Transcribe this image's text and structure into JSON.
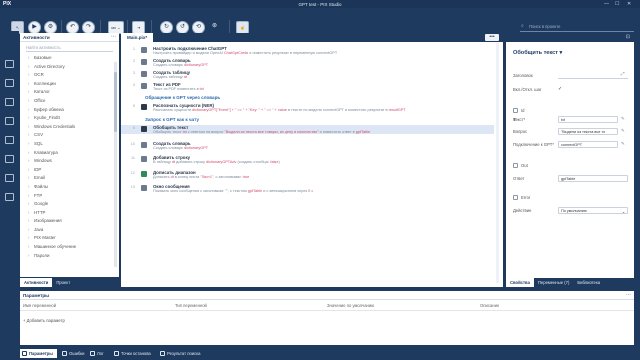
{
  "window": {
    "logo": "PIX",
    "title": "GPT test - PIX Studio"
  },
  "toolbar": {
    "speed_label": "мс ⌄",
    "search_placeholder": "Поиск в проекте"
  },
  "left_panel": {
    "title": "Активности",
    "filter_placeholder": "Найти активность",
    "items": [
      "Базовые",
      "Active Directory",
      "OCR",
      "Коллекции",
      "Каталог",
      "Office",
      "Буфер обмена",
      "Kyube_FindIt",
      "Windows Credentials",
      "CSV",
      "SQL",
      "Клавиатура",
      "Windows",
      "IDP",
      "Email",
      "Файлы",
      "FTP",
      "Google",
      "HTTP",
      "Изображения",
      "Java",
      "PIX Master",
      "Машинное обучение",
      "Пароли"
    ],
    "tabs": [
      "Активности",
      "Проект"
    ]
  },
  "center": {
    "doc_tab": "Main.pix*",
    "menu_label": "•••",
    "steps": [
      {
        "num": "1",
        "title": "Настроить подключение ChatGPT",
        "desc_pre": "Настроить провайдер и модели OpenAI ",
        "desc_hl": "ChatGptCreds",
        "desc_post": " и поместить результат в переменную connectGPT"
      },
      {
        "num": "2",
        "title": "Создать словарь",
        "desc_pre": "Создать словарь ",
        "desc_hl": "dictionaryGPT",
        "desc_post": ""
      },
      {
        "num": "3",
        "title": "Создать таблицу",
        "desc_pre": "Создать таблицу ",
        "desc_hl": "dt",
        "desc_post": ""
      },
      {
        "num": "4",
        "title": "Текст из PDF",
        "desc_pre": "Текст из PDF поместить в ",
        "desc_hl": "txt",
        "desc_post": ""
      },
      {
        "num": "5",
        "title": "Распознать сущности (NER)",
        "desc_pre": "Распознать сущности ",
        "desc_hl": "dictionaryGPT[\"Event\"] + \" => \" + \"Key: \" + \" => \" + value",
        "desc_post": " в тексте по модели connectGPT и поместить результат в ",
        "desc_hl2": "resultGPT"
      },
      {
        "num": "6",
        "title": "Обобщить текст",
        "desc_pre": "Обобщить текст ",
        "desc_hl": "txt",
        "desc_post": " с ответом на вопрос ",
        "desc_hl2": "\"Выдели из текста все товары, их цену и количество\"",
        "desc_post2": " и поместить ответ в ",
        "desc_hl3": "gptTable"
      },
      {
        "num": "10",
        "title": "Создать словарь",
        "desc_pre": "Создать словарь ",
        "desc_hl": "dictionaryGPT",
        "desc_post": ""
      },
      {
        "num": "11",
        "title": "Добавить строку",
        "desc_pre": "В таблицу ",
        "desc_hl": "dt",
        "desc_post": " добавить строку ",
        "desc_hl2": "dictionaryGPTAdv",
        "desc_post2": " (создать столбцы: ",
        "desc_hl3": "false",
        "desc_post3": ")"
      },
      {
        "num": "12",
        "title": "Дописать диапазон",
        "desc_pre": "Дописать ",
        "desc_hl": "dt",
        "desc_post": " в конец листа \"",
        "desc_hl2": "Лист1",
        "desc_post2": "\", с заголовками: ",
        "desc_hl3": "true"
      },
      {
        "num": "13",
        "title": "Окно сообщения",
        "desc_pre": "Показать окно сообщения с заголовком: \"\", с текстом ",
        "desc_hl": "gptTable",
        "desc_post": " и с автозакрытием через ",
        "desc_hl2": "0",
        "desc_post2": " с"
      }
    ],
    "groups": [
      "Обращение к GPT через словарь",
      "Запрос к GPT как к чату"
    ]
  },
  "right_panel": {
    "title": "Обобщить текст",
    "fields": {
      "comment_label": "Заголовок",
      "enabled_label": "Вкл./Откл. шаг",
      "id_label": "Id",
      "text_label": "Текст*",
      "text_value": "txt",
      "question_label": "Вопрос",
      "question_value": "\"Выдели из текста все то",
      "connect_label": "Подключение к GPT*",
      "connect_value": "connectGPT",
      "out_label": "Out",
      "answer_label": "Ответ",
      "answer_value": "gptTable",
      "error_label": "Error",
      "action_label": "Действие",
      "action_value": "По умолчанию"
    },
    "tabs": [
      "Свойства",
      "Переменные (7)",
      "Библиотека"
    ]
  },
  "params": {
    "title": "Параметры",
    "columns": [
      "Имя переменной",
      "Тип переменной",
      "Значение по умолчанию",
      "Описание"
    ],
    "add_label": "+ Добавить параметр"
  },
  "bottom_tabs": [
    "Параметры",
    "Ошибки",
    "Лог",
    "Точки останова",
    "Результат поиска"
  ]
}
